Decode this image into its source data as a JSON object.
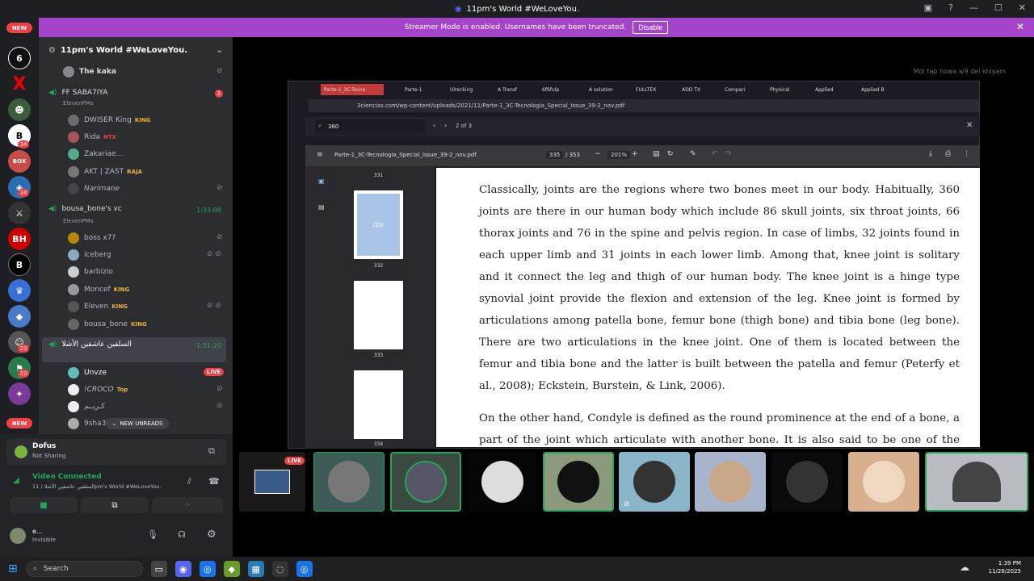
{
  "window_title": "11pm's World #WeLoveYou.",
  "banner": {
    "text": "Streamer Mode is enabled. Usernames have been truncated.",
    "button": "Disable"
  },
  "server_name": "11pm's World #WeLoveYou.",
  "channels": {
    "top_user": "The kaka",
    "vc1": {
      "name": "FF SABA7IYA",
      "sub": "ElevenPMs",
      "badge": "1",
      "users": [
        {
          "name": "DWISER King",
          "tag": "KING"
        },
        {
          "name": "Rida",
          "tag": "NTX"
        },
        {
          "name": "Zakariae...",
          "tag": ""
        },
        {
          "name": "AKT | ZAST",
          "tag": "RAJA"
        },
        {
          "name": "Narimane",
          "tag": ""
        }
      ]
    },
    "vc2": {
      "name": "bousa_bone's vc",
      "sub": "ElevenPMs",
      "time": "1:33:08",
      "users": [
        {
          "name": "boss x7?",
          "tag": ""
        },
        {
          "name": "iceberg",
          "tag": ""
        },
        {
          "name": "barbizio",
          "tag": ""
        },
        {
          "name": "Moncef",
          "tag": "KING"
        },
        {
          "name": "Eleven",
          "tag": "KING"
        },
        {
          "name": "bousa_bone",
          "tag": "KING"
        }
      ]
    },
    "vc3": {
      "name": "السلفين عاشقين الأشلا",
      "time": "1:31:20",
      "users": [
        {
          "name": "Unvze",
          "tag": "LIVE"
        },
        {
          "name": "!CROCO",
          "tag": "Top"
        },
        {
          "name": "كـريــم",
          "tag": ""
        },
        {
          "name": "9sha3i",
          "tag": ""
        }
      ]
    },
    "new_unreads": "NEW UNREADS"
  },
  "guild_badges": [
    "NEW",
    "34",
    "34",
    "34",
    "23",
    "23",
    "NEW"
  ],
  "activity": {
    "name": "Dofus",
    "status": "Not Sharing"
  },
  "voice": {
    "status": "Video Connected",
    "channel": "السلفين عاشقين الأشلا / 11pm's World #WeLoveYou."
  },
  "user": {
    "name": "e...",
    "status": "Invisible"
  },
  "live_badge": "LIVE",
  "overlay_text": "Mol tap howa w9 del khiyam",
  "browser": {
    "tabs": [
      "Parte-1_3C-Tecno",
      "Parte-1",
      "Ulrecking",
      "A Transf",
      "6f6fulp",
      "A solution",
      "FULLTEX",
      "ADD TX",
      "Compari",
      "Physical",
      "Applied",
      "Applied B"
    ],
    "url": "3ciencias.com/wp-content/uploads/2021/11/Parte-1_3C-Tecnologia_Special_Issue_39-2_nov.pdf",
    "find_query": "360",
    "find_count": "2 of 3",
    "pdf_title": "Parte-1_3C-Tecnologia_Special_Issue_39-2_nov.pdf",
    "page_current": "335",
    "page_total": "/ 353",
    "zoom": "201%",
    "thumb_labels": [
      "331",
      "332",
      "333",
      "334"
    ],
    "thumb_text": "/20/",
    "paragraph1": "Classically, joints are the regions where two bones meet in our body. Habitually, 360 joints are there in our human body which include 86 skull joints, six throat joints, 66 thorax joints and 76 in the spine and pelvis region. In case of limbs, 32 joints found in each upper limb and 31 joints in each lower limb. Among that, knee joint is solitary and it connect the leg and thigh of our human body. The knee joint is a hinge type synovial joint provide the flexion and extension of the leg. Knee joint is formed by articulations among patella bone, femur bone (thigh bone) and tibia bone (leg bone). There are two articulations in the knee joint. One of them is located between the femur and tibia bone and the latter is built between the patella and femur (Peterfy et al., 2008); Eckstein, Burstein, & Link, 2006).",
    "paragraph2": "On the other hand, Condyle is defined as the round prominence at the end of a bone, a part of the joint which articulate with another bone. It is also said to be one of the markings or features of bones. In the femur bone of the knee joint, condyles are two types"
  },
  "taskbar": {
    "search": "Search",
    "time": "1:39 PM",
    "date": "11/26/2025"
  },
  "colors": {
    "banner": "#a445c9",
    "live": "#f23f43",
    "connected": "#23a55a"
  }
}
